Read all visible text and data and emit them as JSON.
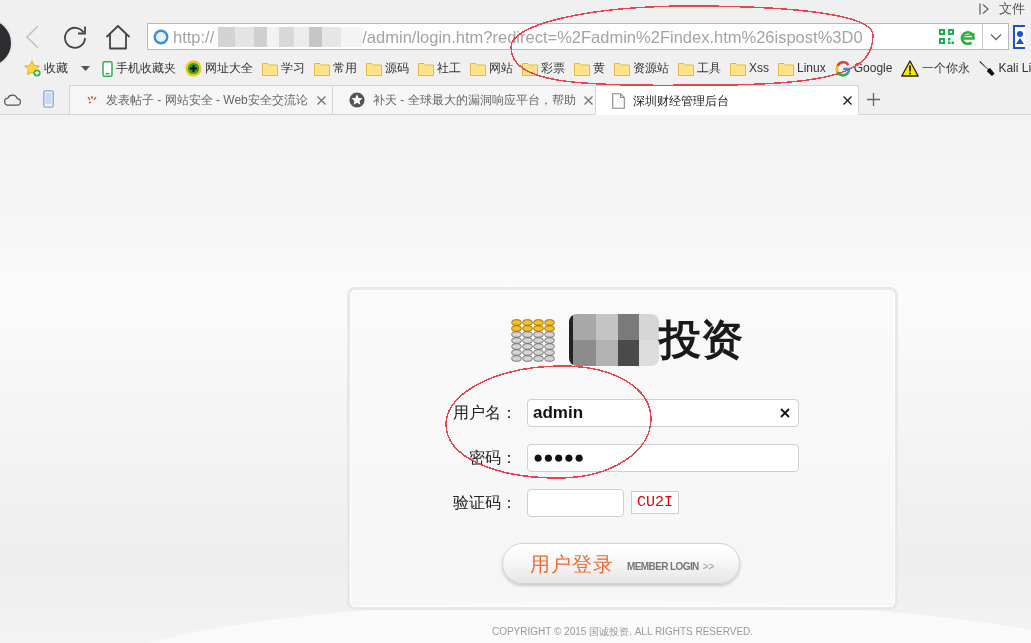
{
  "browser": {
    "menu": "文件",
    "nav_buttons": [
      {
        "kind": "back",
        "disabled": true
      },
      {
        "kind": "reload",
        "disabled": false
      },
      {
        "kind": "home",
        "disabled": false
      }
    ],
    "address": {
      "scheme": "http://",
      "host_redacted": true,
      "rest": "/admin/login.htm?redirect=%2Fadmin%2Findex.htm%26ispost%3D0"
    },
    "bookmarks": [
      {
        "kind": "star",
        "label": "收藏"
      },
      {
        "kind": "phone",
        "label": "手机收藏夹"
      },
      {
        "kind": "site",
        "label": "网址大全"
      },
      {
        "kind": "folder",
        "label": "学习"
      },
      {
        "kind": "folder",
        "label": "常用"
      },
      {
        "kind": "folder",
        "label": "源码"
      },
      {
        "kind": "folder",
        "label": "社工"
      },
      {
        "kind": "folder",
        "label": "网站"
      },
      {
        "kind": "folder",
        "label": "彩票"
      },
      {
        "kind": "folder",
        "label": "黄"
      },
      {
        "kind": "folder",
        "label": "资源站"
      },
      {
        "kind": "folder",
        "label": "工具"
      },
      {
        "kind": "folder",
        "label": "Xss"
      },
      {
        "kind": "folder",
        "label": "Linux"
      },
      {
        "kind": "google",
        "label": "Google"
      },
      {
        "kind": "warning",
        "label": "一个你永"
      },
      {
        "kind": "knife",
        "label": "Kali Li"
      }
    ],
    "tabs": [
      {
        "kind": "marks",
        "title": "发表帖子 - 网站安全 - Web安全交流论",
        "selected": false
      },
      {
        "kind": "star",
        "title": "补天 - 全球最大的漏洞响应平台，帮助",
        "selected": false
      },
      {
        "kind": "page",
        "title": "深圳财经管理后台",
        "selected": true
      }
    ]
  },
  "login": {
    "logo": {
      "name_redacted": true,
      "text": "投资"
    },
    "fields": [
      {
        "kind": "text",
        "label": "用户名：",
        "value": "admin",
        "clearable": true
      },
      {
        "kind": "password",
        "label": "密码：",
        "value": "●●●●●",
        "clearable": false
      },
      {
        "kind": "captcha",
        "label": "验证码：",
        "captcha": "CU2I",
        "clearable": false
      }
    ],
    "button": {
      "label": "用户登录",
      "sub_label": "MEMBER LOGIN",
      "arrow": ">>"
    }
  },
  "footer": "COPYRIGHT © 2015 国诚投资. ALL RIGHTS RESERVED.",
  "annotations": [
    {
      "kind": "ellipse",
      "color": "#e8454a"
    },
    {
      "kind": "ellipse",
      "color": "#e8454a"
    }
  ]
}
